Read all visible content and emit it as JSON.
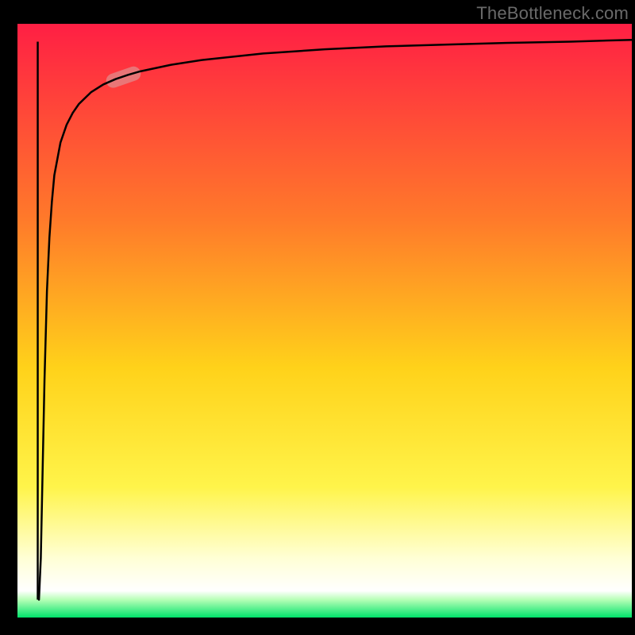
{
  "watermark": "TheBottleneck.com",
  "chart_data": {
    "type": "line",
    "title": "",
    "xlabel": "",
    "ylabel": "",
    "xlim": [
      0,
      100
    ],
    "ylim": [
      0,
      100
    ],
    "grid": false,
    "legend": false,
    "axes_visible": false,
    "background_gradient": {
      "stops": [
        {
          "offset": 0.0,
          "color": "#ff1f44"
        },
        {
          "offset": 0.33,
          "color": "#ff7a2a"
        },
        {
          "offset": 0.58,
          "color": "#ffd21a"
        },
        {
          "offset": 0.78,
          "color": "#fff44a"
        },
        {
          "offset": 0.9,
          "color": "#ffffd5"
        },
        {
          "offset": 0.955,
          "color": "#ffffff"
        },
        {
          "offset": 0.97,
          "color": "#b6ffb6"
        },
        {
          "offset": 1.0,
          "color": "#00e26a"
        }
      ]
    },
    "series": [
      {
        "name": "curve",
        "type": "line",
        "x": [
          3.5,
          3.8,
          4.1,
          4.4,
          4.8,
          5.2,
          5.6,
          6.0,
          7.0,
          8.0,
          9.0,
          10.0,
          12.0,
          14.0,
          16.0,
          18.0,
          20.0,
          25.0,
          30.0,
          40.0,
          50.0,
          60.0,
          70.0,
          80.0,
          90.0,
          100.0
        ],
        "y": [
          3.0,
          10.0,
          25.0,
          40.0,
          55.0,
          64.0,
          70.0,
          74.5,
          80.0,
          83.0,
          85.0,
          86.5,
          88.5,
          89.8,
          90.7,
          91.4,
          92.0,
          93.1,
          93.9,
          95.0,
          95.7,
          96.2,
          96.5,
          96.8,
          97.0,
          97.3
        ]
      },
      {
        "name": "vertical-tick",
        "type": "line",
        "x": [
          3.3,
          3.3
        ],
        "y": [
          3.0,
          97.0
        ]
      }
    ],
    "highlight": {
      "x_range": [
        14.5,
        20.0
      ],
      "y_range": [
        89.8,
        92.0
      ],
      "color": "#e09090",
      "opacity": 0.7
    }
  }
}
